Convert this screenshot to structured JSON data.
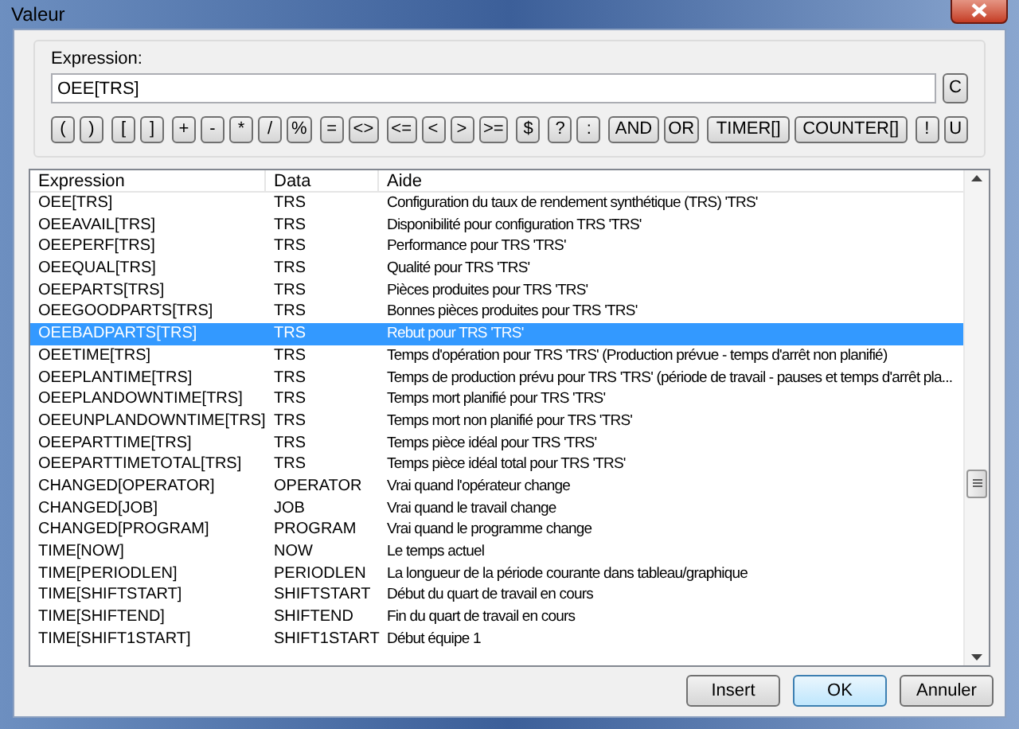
{
  "window": {
    "title": "Valeur"
  },
  "expression": {
    "label": "Expression:",
    "value": "OEE[TRS]",
    "clear_button": "C"
  },
  "operator_groups": [
    [
      "(",
      ")"
    ],
    [
      "[",
      "]"
    ],
    [
      "+",
      "-",
      "*",
      "/",
      "%"
    ],
    [
      "=",
      "<>"
    ],
    [
      "<=",
      "<",
      ">",
      ">="
    ],
    [
      "$"
    ],
    [
      "?",
      ":"
    ],
    [
      "AND",
      "OR"
    ],
    [
      "TIMER[]",
      "COUNTER[]"
    ],
    [
      "!",
      "U"
    ]
  ],
  "table": {
    "columns": [
      "Expression",
      "Data",
      "Aide"
    ],
    "rows": [
      {
        "expression": "OEE[TRS]",
        "data": "TRS",
        "aide": "Configuration du taux de rendement synthétique (TRS) 'TRS'",
        "selected": false
      },
      {
        "expression": "OEEAVAIL[TRS]",
        "data": "TRS",
        "aide": "Disponibilité pour configuration TRS 'TRS'",
        "selected": false
      },
      {
        "expression": "OEEPERF[TRS]",
        "data": "TRS",
        "aide": "Performance pour TRS 'TRS'",
        "selected": false
      },
      {
        "expression": "OEEQUAL[TRS]",
        "data": "TRS",
        "aide": "Qualité pour TRS 'TRS'",
        "selected": false
      },
      {
        "expression": "OEEPARTS[TRS]",
        "data": "TRS",
        "aide": "Pièces produites pour TRS 'TRS'",
        "selected": false
      },
      {
        "expression": "OEEGOODPARTS[TRS]",
        "data": "TRS",
        "aide": "Bonnes pièces produites pour TRS 'TRS'",
        "selected": false
      },
      {
        "expression": "OEEBADPARTS[TRS]",
        "data": "TRS",
        "aide": "Rebut pour TRS 'TRS'",
        "selected": true
      },
      {
        "expression": "OEETIME[TRS]",
        "data": "TRS",
        "aide": "Temps d'opération pour TRS 'TRS' (Production prévue - temps d'arrêt non planifié)",
        "selected": false
      },
      {
        "expression": "OEEPLANTIME[TRS]",
        "data": "TRS",
        "aide": "Temps de production prévu pour TRS 'TRS' (période de travail - pauses et temps d'arrêt pla...",
        "selected": false
      },
      {
        "expression": "OEEPLANDOWNTIME[TRS]",
        "data": "TRS",
        "aide": "Temps mort planifié pour TRS 'TRS'",
        "selected": false
      },
      {
        "expression": "OEEUNPLANDOWNTIME[TRS]",
        "data": "TRS",
        "aide": "Temps mort non planifié pour TRS 'TRS'",
        "selected": false
      },
      {
        "expression": "OEEPARTTIME[TRS]",
        "data": "TRS",
        "aide": "Temps pièce idéal pour TRS 'TRS'",
        "selected": false
      },
      {
        "expression": "OEEPARTTIMETOTAL[TRS]",
        "data": "TRS",
        "aide": "Temps pièce idéal total pour TRS 'TRS'",
        "selected": false
      },
      {
        "expression": "CHANGED[OPERATOR]",
        "data": "OPERATOR",
        "aide": "Vrai quand l'opérateur change",
        "selected": false
      },
      {
        "expression": "CHANGED[JOB]",
        "data": "JOB",
        "aide": "Vrai quand le travail change",
        "selected": false
      },
      {
        "expression": "CHANGED[PROGRAM]",
        "data": "PROGRAM",
        "aide": "Vrai quand le programme change",
        "selected": false
      },
      {
        "expression": "TIME[NOW]",
        "data": "NOW",
        "aide": "Le temps actuel",
        "selected": false
      },
      {
        "expression": "TIME[PERIODLEN]",
        "data": "PERIODLEN",
        "aide": "La longueur de la période courante dans tableau/graphique",
        "selected": false
      },
      {
        "expression": "TIME[SHIFTSTART]",
        "data": "SHIFTSTART",
        "aide": "Début du quart de travail en cours",
        "selected": false
      },
      {
        "expression": "TIME[SHIFTEND]",
        "data": "SHIFTEND",
        "aide": "Fin du quart de travail en cours",
        "selected": false
      },
      {
        "expression": "TIME[SHIFT1START]",
        "data": "SHIFT1START",
        "aide": "Début équipe 1",
        "selected": false
      }
    ]
  },
  "buttons": [
    {
      "label": "Insert",
      "default": false
    },
    {
      "label": "OK",
      "default": true
    },
    {
      "label": "Annuler",
      "default": false
    }
  ]
}
